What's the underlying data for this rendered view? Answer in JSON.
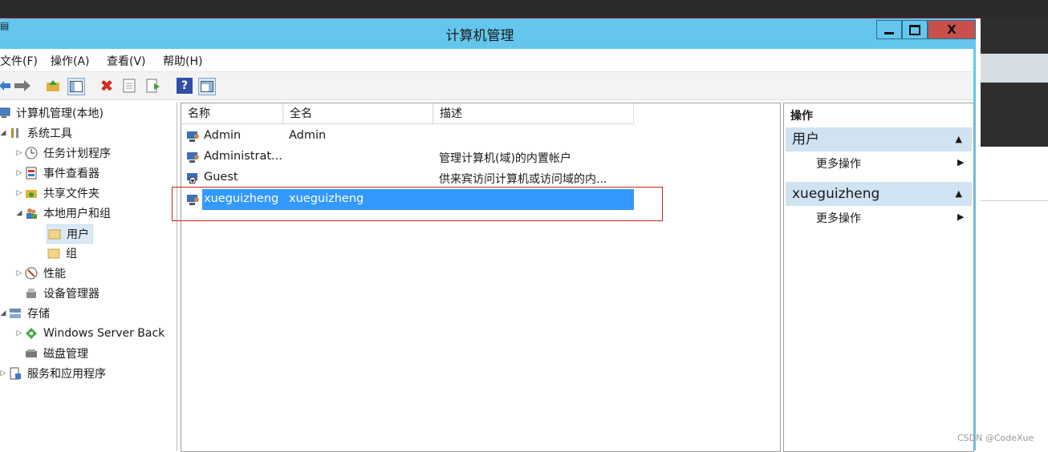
{
  "window": {
    "title": "计算机管理"
  },
  "menu": [
    "文件(F)",
    "操作(A)",
    "查看(V)",
    "帮助(H)"
  ],
  "tree": [
    {
      "label": "计算机管理(本地)",
      "icon": "computer-icon"
    },
    {
      "label": "系统工具",
      "icon": "tools-icon"
    },
    {
      "label": "任务计划程序",
      "icon": "clock-icon"
    },
    {
      "label": "事件查看器",
      "icon": "event-viewer-icon"
    },
    {
      "label": "共享文件夹",
      "icon": "shared-folder-icon"
    },
    {
      "label": "本地用户和组",
      "icon": "users-group-icon"
    },
    {
      "label": "用户",
      "icon": "folder-icon"
    },
    {
      "label": "组",
      "icon": "folder-icon"
    },
    {
      "label": "性能",
      "icon": "performance-icon"
    },
    {
      "label": "设备管理器",
      "icon": "device-manager-icon"
    },
    {
      "label": "存储",
      "icon": "storage-icon"
    },
    {
      "label": "Windows Server Back",
      "icon": "backup-icon"
    },
    {
      "label": "磁盘管理",
      "icon": "disk-icon"
    },
    {
      "label": "服务和应用程序",
      "icon": "services-icon"
    }
  ],
  "list": {
    "columns": [
      "名称",
      "全名",
      "描述"
    ],
    "rows": [
      {
        "name": "Admin",
        "fullname": "Admin",
        "desc": ""
      },
      {
        "name": "Administrat...",
        "fullname": "",
        "desc": "管理计算机(域)的内置帐户"
      },
      {
        "name": "Guest",
        "fullname": "",
        "desc": "供来宾访问计算机或访问域的内..."
      },
      {
        "name": "xueguizheng",
        "fullname": "xueguizheng",
        "desc": ""
      }
    ]
  },
  "actions": {
    "header": "操作",
    "sections": [
      {
        "title": "用户",
        "item": "更多操作"
      },
      {
        "title": "xueguizheng",
        "item": "更多操作"
      }
    ]
  },
  "watermark": "CSDN @CodeXue",
  "colors": {
    "titlebar": "#64c6ec",
    "selection": "#3399ff",
    "highlight_box": "#cc2222",
    "section_bg": "#cfe3f2"
  }
}
